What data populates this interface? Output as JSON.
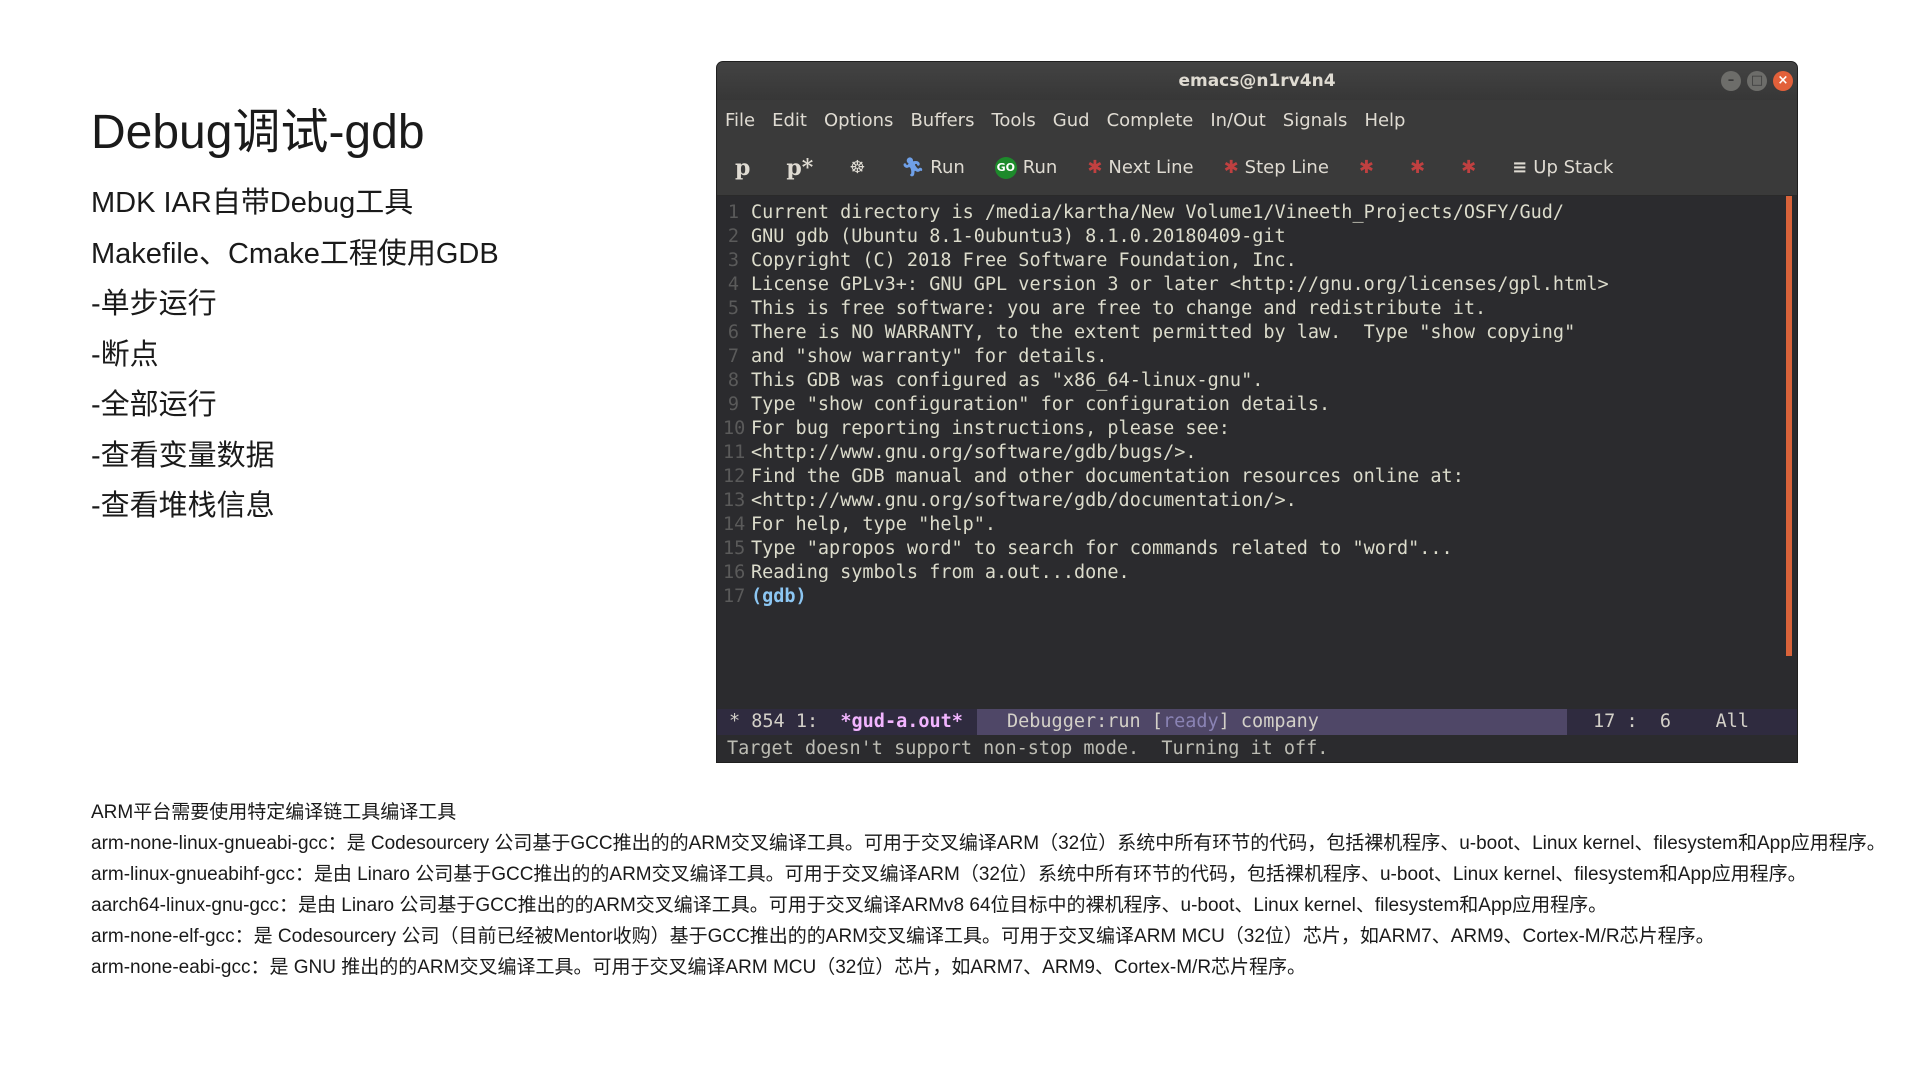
{
  "slide": {
    "title": "Debug调试-gdb",
    "bullets": [
      "MDK IAR自带Debug工具",
      "Makefile、Cmake工程使用GDB",
      "-单步运行",
      "-断点",
      "-全部运行",
      "-查看变量数据",
      "-查看堆栈信息"
    ],
    "notes": [
      "ARM平台需要使用特定编译链工具编译工具",
      "arm-none-linux-gnueabi-gcc：是 Codesourcery 公司基于GCC推出的的ARM交叉编译工具。可用于交叉编译ARM（32位）系统中所有环节的代码，包括裸机程序、u-boot、Linux kernel、filesystem和App应用程序。",
      "arm-linux-gnueabihf-gcc：是由 Linaro 公司基于GCC推出的的ARM交叉编译工具。可用于交叉编译ARM（32位）系统中所有环节的代码，包括裸机程序、u-boot、Linux kernel、filesystem和App应用程序。",
      "aarch64-linux-gnu-gcc：是由 Linaro 公司基于GCC推出的的ARM交叉编译工具。可用于交叉编译ARMv8 64位目标中的裸机程序、u-boot、Linux kernel、filesystem和App应用程序。",
      "arm-none-elf-gcc：是 Codesourcery 公司（目前已经被Mentor收购）基于GCC推出的的ARM交叉编译工具。可用于交叉编译ARM MCU（32位）芯片，如ARM7、ARM9、Cortex-M/R芯片程序。",
      "arm-none-eabi-gcc：是 GNU 推出的的ARM交叉编译工具。可用于交叉编译ARM MCU（32位）芯片，如ARM7、ARM9、Cortex-M/R芯片程序。"
    ]
  },
  "window": {
    "title": "emacs@n1rv4n4",
    "menu": [
      "File",
      "Edit",
      "Options",
      "Buffers",
      "Tools",
      "Gud",
      "Complete",
      "In/Out",
      "Signals",
      "Help"
    ],
    "toolbar": {
      "p_icon": "p",
      "pstar_icon": "p*",
      "run1_label": "Run",
      "go_icon": "GO",
      "run2_label": "Run",
      "next_line_label": "Next Line",
      "step_line_label": "Step Line",
      "up_stack_label": "Up Stack"
    },
    "lines": [
      {
        "n": "1",
        "t": "Current directory is /media/kartha/New Volume1/Vineeth_Projects/OSFY/Gud/"
      },
      {
        "n": "2",
        "t": "GNU gdb (Ubuntu 8.1-0ubuntu3) 8.1.0.20180409-git"
      },
      {
        "n": "3",
        "t": "Copyright (C) 2018 Free Software Foundation, Inc."
      },
      {
        "n": "4",
        "t": "License GPLv3+: GNU GPL version 3 or later <http://gnu.org/licenses/gpl.html>"
      },
      {
        "n": "5",
        "t": "This is free software: you are free to change and redistribute it."
      },
      {
        "n": "6",
        "t": "There is NO WARRANTY, to the extent permitted by law.  Type \"show copying\""
      },
      {
        "n": "7",
        "t": "and \"show warranty\" for details."
      },
      {
        "n": "8",
        "t": "This GDB was configured as \"x86_64-linux-gnu\"."
      },
      {
        "n": "9",
        "t": "Type \"show configuration\" for configuration details."
      },
      {
        "n": "10",
        "t": "For bug reporting instructions, please see:"
      },
      {
        "n": "11",
        "t": "<http://www.gnu.org/software/gdb/bugs/>."
      },
      {
        "n": "12",
        "t": "Find the GDB manual and other documentation resources online at:"
      },
      {
        "n": "13",
        "t": "<http://www.gnu.org/software/gdb/documentation/>."
      },
      {
        "n": "14",
        "t": "For help, type \"help\"."
      },
      {
        "n": "15",
        "t": "Type \"apropos word\" to search for commands related to \"word\"..."
      },
      {
        "n": "16",
        "t": "Reading symbols from a.out...done."
      },
      {
        "n": "17",
        "t": "(gdb)"
      }
    ],
    "modeline": {
      "left": "* 854 1:",
      "buffer": "*gud-a.out*",
      "mode_prefix": "Debugger:run [",
      "ready": "ready",
      "mode_suffix": "] company",
      "position": "17 :  6",
      "scroll": "All"
    },
    "minibuffer": "Target doesn't support non-stop mode.  Turning it off."
  }
}
